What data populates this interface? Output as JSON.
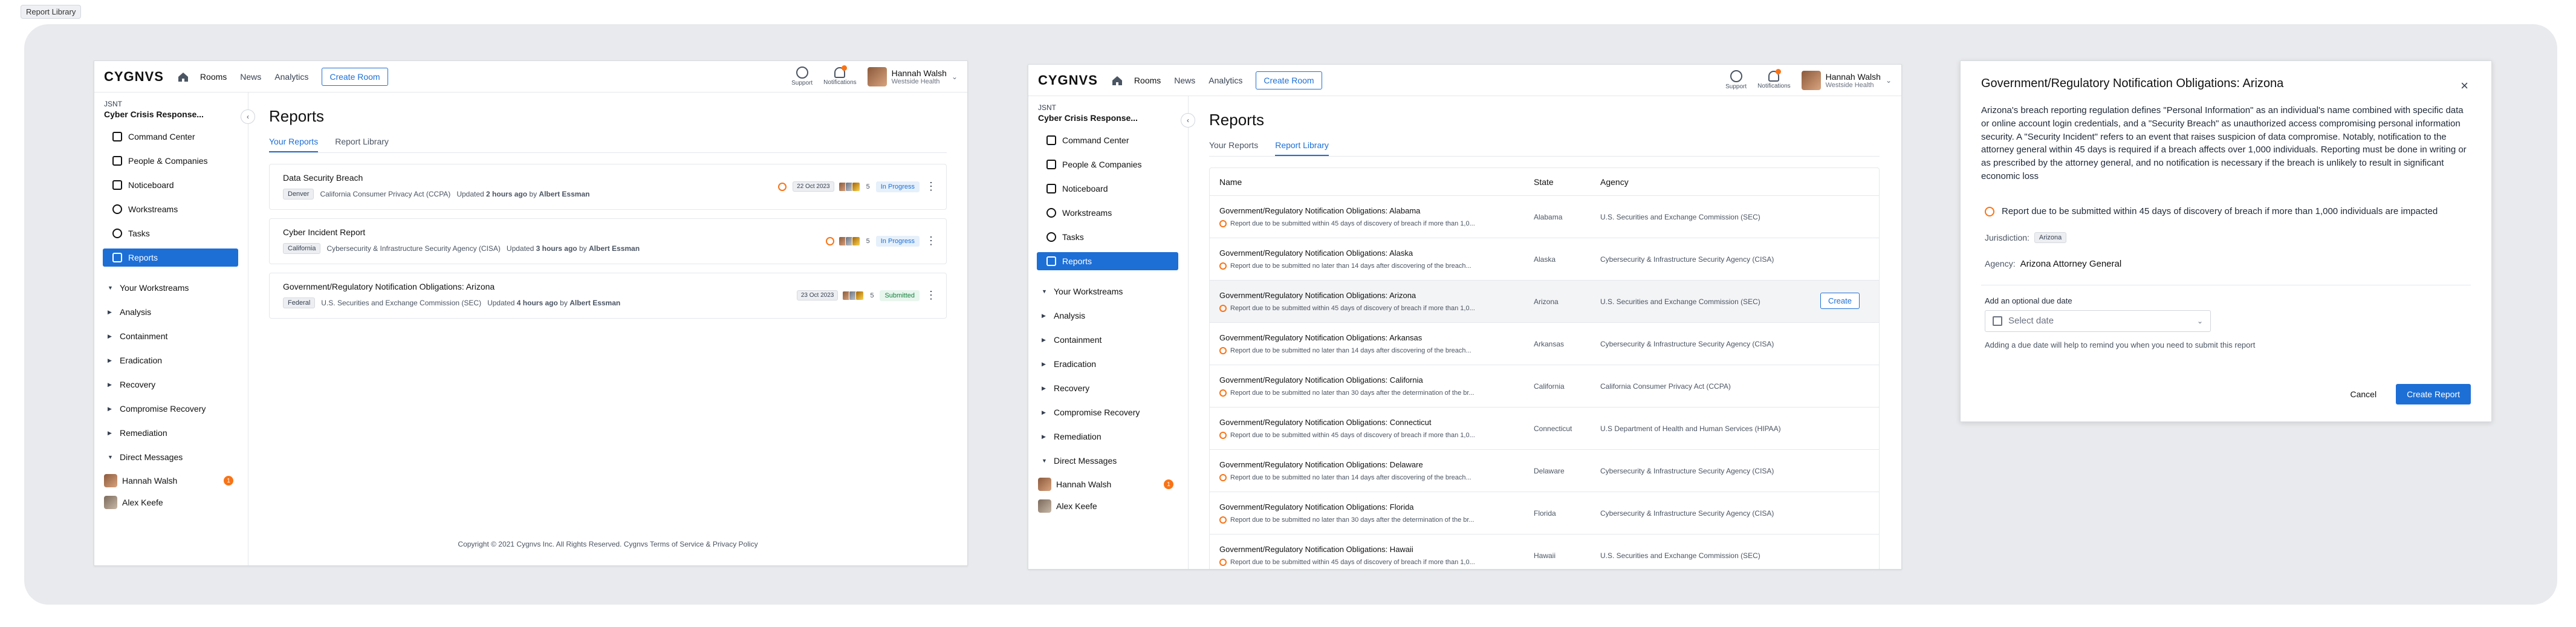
{
  "canvas_label": "Report Library",
  "app": {
    "logo": "CYGNVS",
    "nav": [
      "Rooms",
      "News",
      "Analytics"
    ],
    "create_room": "Create Room",
    "support": "Support",
    "notifications": "Notifications",
    "user_name": "Hannah Walsh",
    "user_org": "Westside Health"
  },
  "sidebar": {
    "org_abbr": "JSNT",
    "org_name": "Cyber Crisis Response...",
    "items": [
      "Command Center",
      "People & Companies",
      "Noticeboard",
      "Workstreams",
      "Tasks",
      "Reports"
    ],
    "workstreams_header": "Your Workstreams",
    "workstreams": [
      "Analysis",
      "Containment",
      "Eradication",
      "Recovery",
      "Compromise Recovery",
      "Remediation"
    ],
    "dm_header": "Direct Messages",
    "dms": [
      {
        "name": "Hannah Walsh",
        "badge": "1"
      },
      {
        "name": "Alex Keefe",
        "badge": ""
      }
    ]
  },
  "reports_page": {
    "title": "Reports",
    "tabs": [
      "Your Reports",
      "Report Library"
    ],
    "cards": [
      {
        "title": "Data Security Breach",
        "tag": "Denver",
        "law": "California Consumer Privacy Act (CCPA)",
        "updated_prefix": "Updated",
        "updated_when": "2 hours ago",
        "by": "by",
        "author": "Albert Essman",
        "date": "22 Oct 2023",
        "count": "5",
        "status": "In Progress",
        "has_clock": true
      },
      {
        "title": "Cyber Incident Report",
        "tag": "California",
        "law": "Cybersecurity & Infrastructure Security Agency (CISA)",
        "updated_prefix": "Updated",
        "updated_when": "3 hours ago",
        "by": "by",
        "author": "Albert Essman",
        "date": "",
        "count": "5",
        "status": "In Progress",
        "has_clock": true
      },
      {
        "title": "Government/Regulatory Notification Obligations: Arizona",
        "tag": "Federal",
        "law": "U.S. Securities and Exchange Commission (SEC)",
        "updated_prefix": "Updated",
        "updated_when": "4 hours ago",
        "by": "by",
        "author": "Albert Essman",
        "date": "23 Oct 2023",
        "count": "5",
        "status": "Submitted",
        "has_clock": false
      }
    ],
    "footer": "Copyright © 2021 Cygnvs Inc. All Rights Reserved. Cygnvs Terms of Service & Privacy Policy"
  },
  "library_page": {
    "title": "Reports",
    "tabs": [
      "Your Reports",
      "Report Library"
    ],
    "columns": [
      "Name",
      "State",
      "Agency"
    ],
    "create_label": "Create",
    "rows": [
      {
        "title": "Government/Regulatory Notification Obligations: Alabama",
        "sub": "Report due to be submitted within 45 days of discovery of breach if more than 1,0...",
        "state": "Alabama",
        "agency": "U.S. Securities and Exchange Commission (SEC)"
      },
      {
        "title": "Government/Regulatory Notification Obligations: Alaska",
        "sub": "Report due to be submitted no later than 14 days after discovering of the breach...",
        "state": "Alaska",
        "agency": "Cybersecurity & Infrastructure Security Agency (CISA)"
      },
      {
        "title": "Government/Regulatory Notification Obligations: Arizona",
        "sub": "Report due to be submitted within 45 days of discovery of breach if more than 1,0...",
        "state": "Arizona",
        "agency": "U.S. Securities and Exchange Commission (SEC)"
      },
      {
        "title": "Government/Regulatory Notification Obligations: Arkansas",
        "sub": "Report due to be submitted no later than 14 days after discovering of the breach...",
        "state": "Arkansas",
        "agency": "Cybersecurity & Infrastructure Security Agency (CISA)"
      },
      {
        "title": "Government/Regulatory Notification Obligations: California",
        "sub": "Report due to be submitted no later than 30 days after the determination of the br...",
        "state": "California",
        "agency": "California Consumer Privacy Act (CCPA)"
      },
      {
        "title": "Government/Regulatory Notification Obligations: Connecticut",
        "sub": "Report due to be submitted within 45 days of discovery of breach if more than 1,0...",
        "state": "Connecticut",
        "agency": "U.S Department of Health and Human Services (HIPAA)"
      },
      {
        "title": "Government/Regulatory Notification Obligations: Delaware",
        "sub": "Report due to be submitted no later than 14 days after discovering of the breach...",
        "state": "Delaware",
        "agency": "Cybersecurity & Infrastructure Security Agency (CISA)"
      },
      {
        "title": "Government/Regulatory Notification Obligations: Florida",
        "sub": "Report due to be submitted no later than 30 days after the determination of the br...",
        "state": "Florida",
        "agency": "Cybersecurity & Infrastructure Security Agency (CISA)"
      },
      {
        "title": "Government/Regulatory Notification Obligations: Hawaii",
        "sub": "Report due to be submitted within 45 days of discovery of breach if more than 1,0...",
        "state": "Hawaii",
        "agency": "U.S. Securities and Exchange Commission (SEC)"
      }
    ]
  },
  "modal": {
    "title": "Government/Regulatory Notification Obligations: Arizona",
    "description": "Arizona's breach reporting regulation defines \"Personal Information\" as an individual's name combined with specific data or online account login credentials, and a \"Security Breach\" as unauthorized access compromising personal information security. A \"Security Incident\" refers to an event that raises suspicion of data compromise. Notably, notification to the attorney general within 45 days is required if a breach affects over 1,000 individuals. Reporting must be done in writing or as prescribed by the attorney general, and no notification is necessary if the breach is unlikely to result in significant economic loss",
    "notice": "Report due to be submitted within 45 days of discovery of breach if more than 1,000 individuals are impacted",
    "jurisdiction_label": "Jurisdiction:",
    "jurisdiction_value": "Arizona",
    "agency_label": "Agency:",
    "agency_value": "Arizona Attorney General",
    "due_date_label": "Add an optional due date",
    "date_placeholder": "Select date",
    "hint": "Adding a due date will help to remind you when you need to submit this report",
    "cancel": "Cancel",
    "create": "Create Report"
  },
  "colors": {
    "accent": "#1d6fd6",
    "warning": "#f97316",
    "success": "#15803d"
  }
}
